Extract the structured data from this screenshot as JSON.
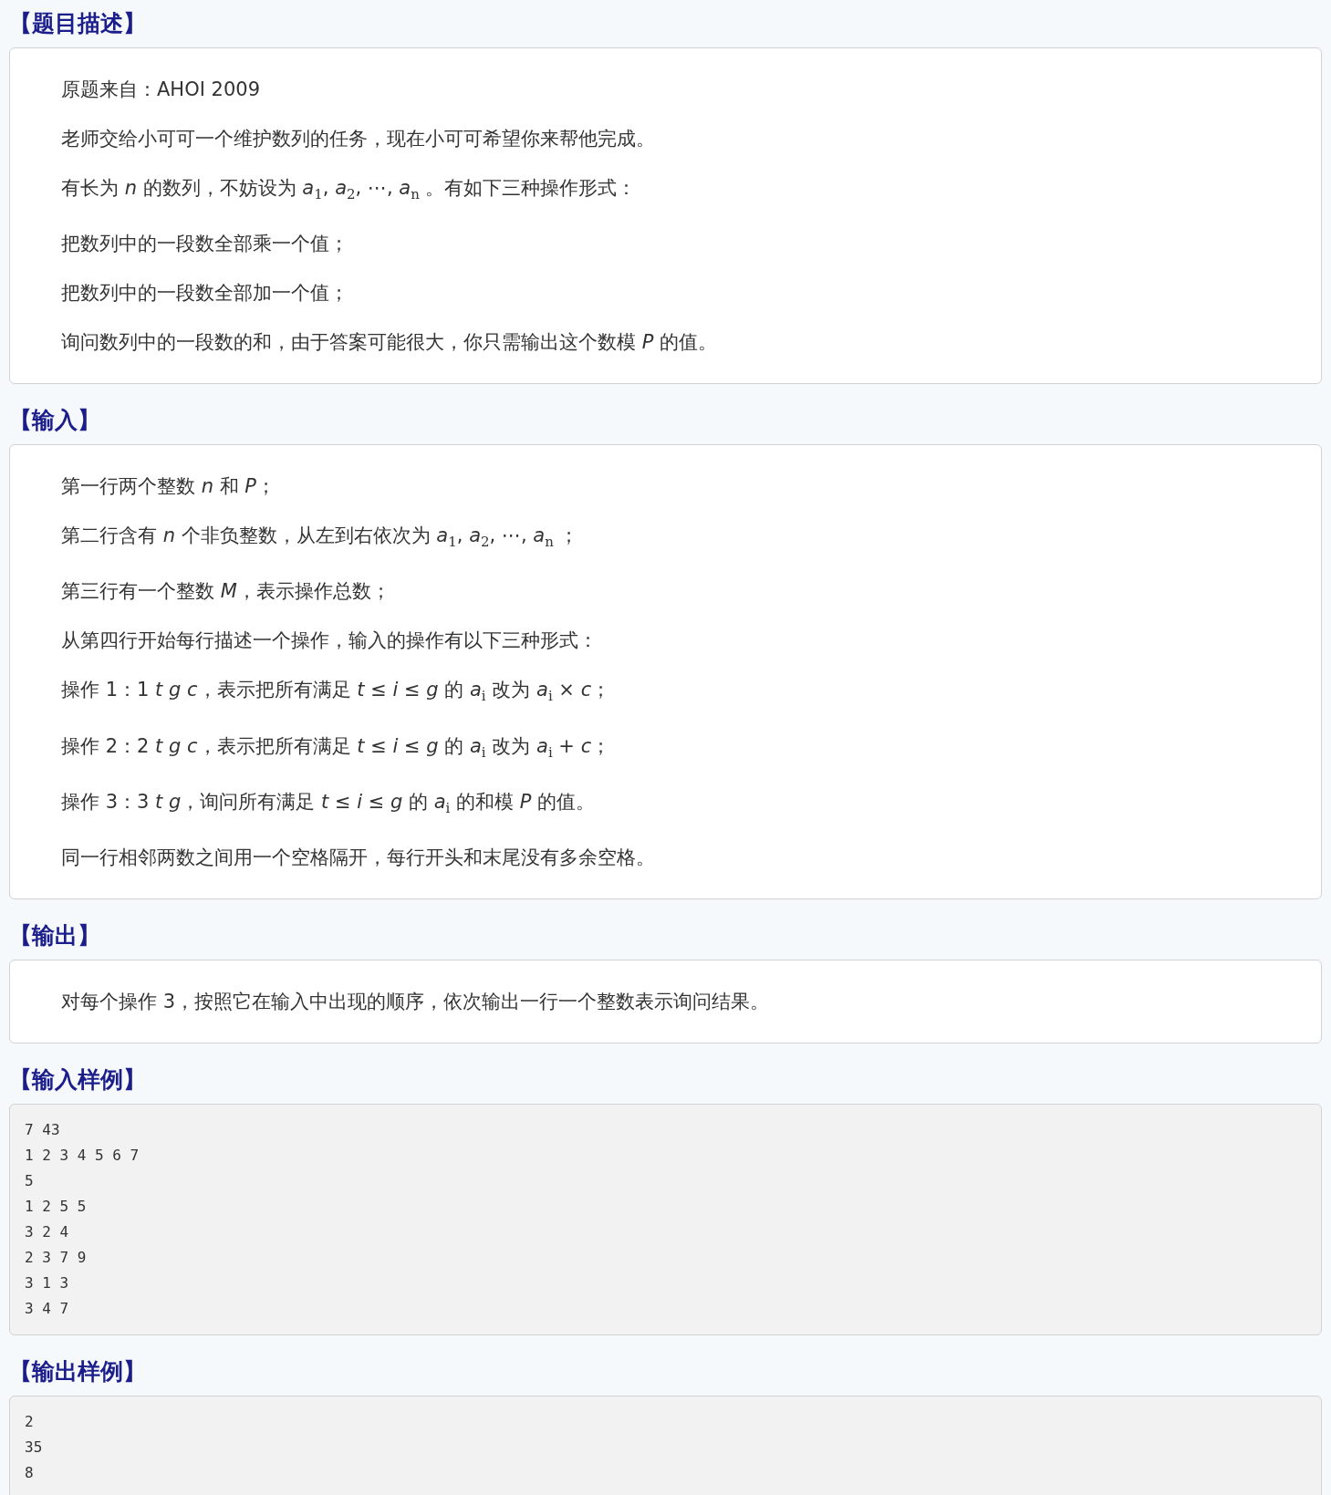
{
  "sections": [
    {
      "heading": "【题目描述】",
      "kind": "text",
      "paragraphs": [
        "原题来自：AHOI 2009",
        "老师交给小可可一个维护数列的任务，现在小可可希望你来帮他完成。",
        "有长为 *n* 的数列，不妨设为 *a*$_{1}$, *a*$_{2}$, ⋯, *a*$_{n}$ 。有如下三种操作形式：",
        "把数列中的一段数全部乘一个值；",
        "把数列中的一段数全部加一个值；",
        "询问数列中的一段数的和，由于答案可能很大，你只需输出这个数模 *P* 的值。"
      ]
    },
    {
      "heading": "【输入】",
      "kind": "text",
      "paragraphs": [
        "第一行两个整数 *n* 和 *P*；",
        "第二行含有 *n* 个非负整数，从左到右依次为 *a*$_{1}$, *a*$_{2}$, ⋯, *a*$_{n}$ ；",
        "第三行有一个整数 *M*，表示操作总数；",
        "从第四行开始每行描述一个操作，输入的操作有以下三种形式：",
        "操作 1：1 *t* *g* *c*，表示把所有满足 *t* ≤ *i* ≤ *g* 的 *a*$_{i}$ 改为 *a*$_{i}$ × *c*；",
        "操作 2：2 *t* *g* *c*，表示把所有满足 *t* ≤ *i* ≤ *g* 的 *a*$_{i}$ 改为 *a*$_{i}$ + *c*；",
        "操作 3：3 *t* *g*，询问所有满足 *t* ≤ *i* ≤ *g* 的 *a*$_{i}$ 的和模 *P* 的值。",
        "同一行相邻两数之间用一个空格隔开，每行开头和末尾没有多余空格。"
      ]
    },
    {
      "heading": "【输出】",
      "kind": "text",
      "paragraphs": [
        "对每个操作 3，按照它在输入中出现的顺序，依次输出一行一个整数表示询问结果。"
      ]
    },
    {
      "heading": "【输入样例】",
      "kind": "code",
      "lines": [
        "7 43",
        "1 2 3 4 5 6 7",
        "5",
        "1 2 5 5",
        "3 2 4",
        "2 3 7 9",
        "3 1 3",
        "3 4 7"
      ]
    },
    {
      "heading": "【输出样例】",
      "kind": "code",
      "lines": [
        "2",
        "35",
        "8"
      ]
    }
  ]
}
